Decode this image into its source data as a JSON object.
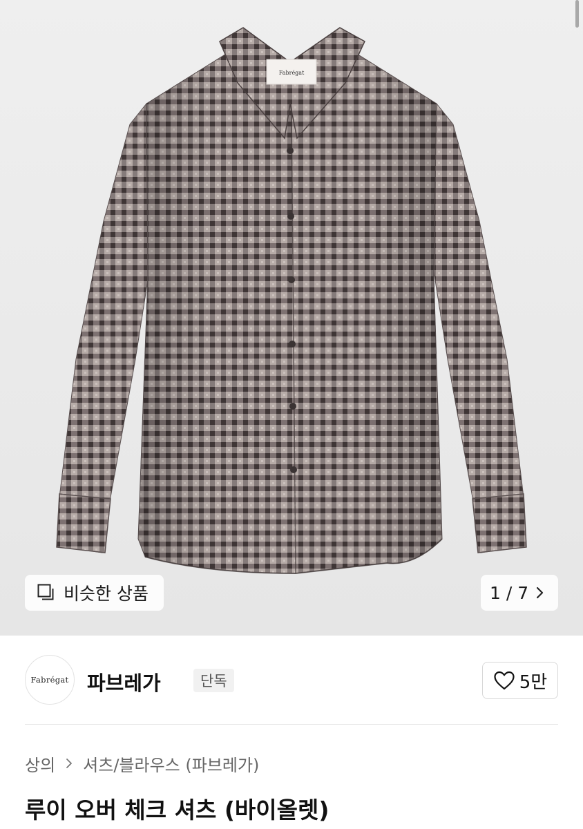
{
  "gallery": {
    "similar_label": "비슷한 상품",
    "counter": "1 / 7",
    "shirt_label_text": "Fabrégat",
    "colors": {
      "background": "#ececec",
      "shirt_base": "#8a7f7f",
      "check_dark": "#4a4040"
    }
  },
  "brand": {
    "logo_text": "Fabrégat",
    "name": "파브레가",
    "badge": "단독",
    "likes": "5만"
  },
  "breadcrumb": {
    "items": [
      "상의",
      "셔츠/블라우스 (파브레가)"
    ]
  },
  "product": {
    "title": "루이 오버 체크 셔츠 (바이올렛)"
  }
}
